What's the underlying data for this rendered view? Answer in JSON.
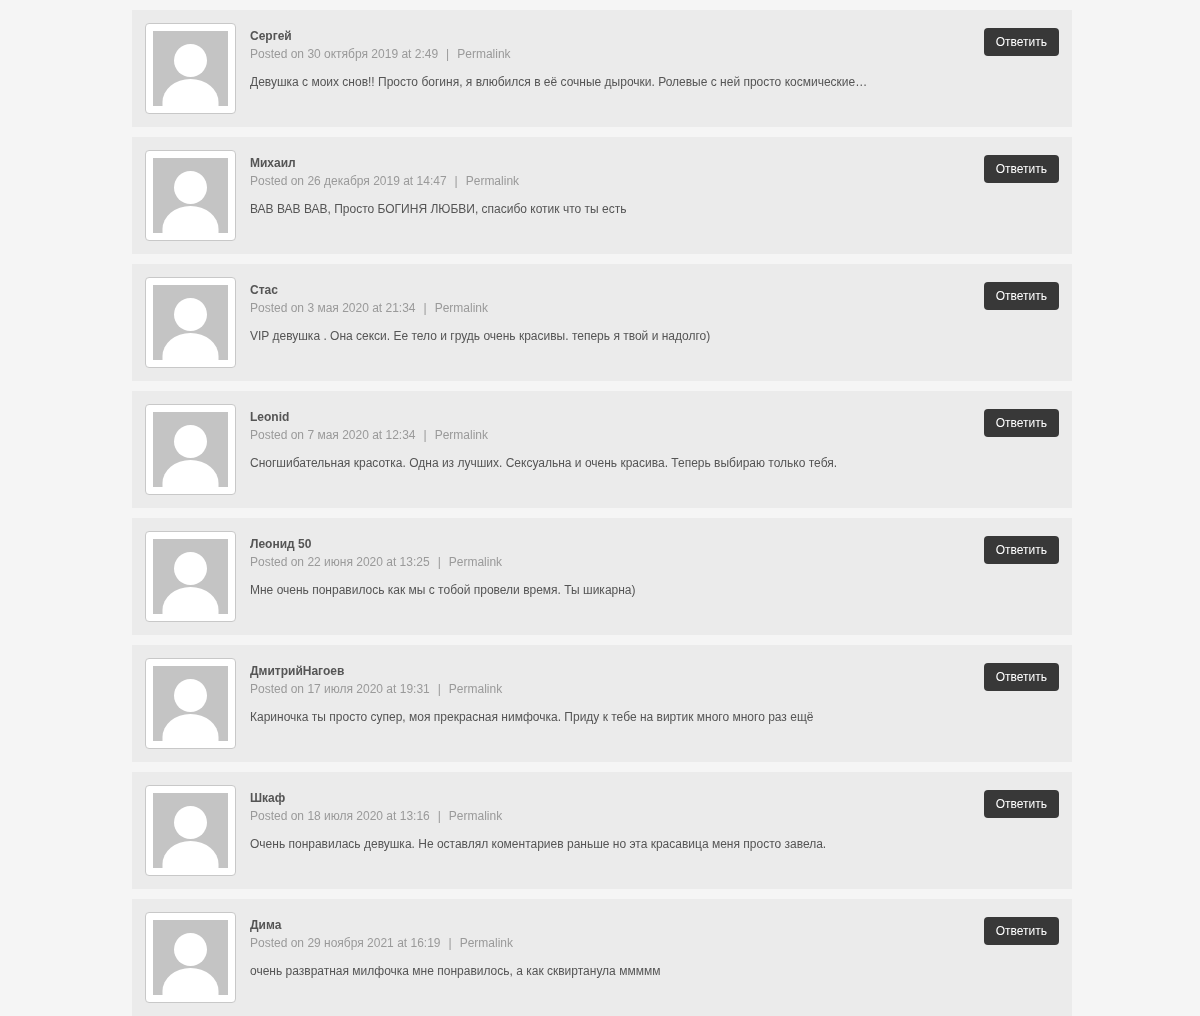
{
  "comments": [
    {
      "author": "Сергей",
      "posted": "Posted on 30 октября 2019 at 2:49",
      "separator": "|",
      "permalink": "Permalink",
      "text": "Девушка с моих снов!! Просто богиня, я влюбился в её сочные дырочки. Ролевые с ней просто космические…",
      "reply": "Ответить"
    },
    {
      "author": "Михаил",
      "posted": "Posted on 26 декабря 2019 at 14:47",
      "separator": "|",
      "permalink": "Permalink",
      "text": "ВАВ ВАВ ВАВ, Просто БОГИНЯ ЛЮБВИ, спасибо котик что ты есть",
      "reply": "Ответить"
    },
    {
      "author": "Стас",
      "posted": "Posted on 3 мая 2020 at 21:34",
      "separator": "|",
      "permalink": "Permalink",
      "text": "VIP девушка . Она секси. Ее тело и грудь очень красивы. теперь я твой и надолго)",
      "reply": "Ответить"
    },
    {
      "author": "Leonid",
      "posted": "Posted on 7 мая 2020 at 12:34",
      "separator": "|",
      "permalink": "Permalink",
      "text": "Сногшибательная красотка. Одна из лучших. Сексуальна и очень красива. Теперь выбираю только тебя.",
      "reply": "Ответить"
    },
    {
      "author": "Леонид 50",
      "posted": "Posted on 22 июня 2020 at 13:25",
      "separator": "|",
      "permalink": "Permalink",
      "text": "Мне очень понравилось как мы с тобой провели время. Ты шикарна)",
      "reply": "Ответить"
    },
    {
      "author": "ДмитрийНагоев",
      "posted": "Posted on 17 июля 2020 at 19:31",
      "separator": "|",
      "permalink": "Permalink",
      "text": "Кариночка ты просто супер, моя прекрасная нимфочка. Приду к тебе на виртик много много раз ещё",
      "reply": "Ответить"
    },
    {
      "author": "Шкаф",
      "posted": "Posted on 18 июля 2020 at 13:16",
      "separator": "|",
      "permalink": "Permalink",
      "text": "Очень понравилась девушка. Не оставлял коментариев раньше но эта красавица меня просто завела.",
      "reply": "Ответить"
    },
    {
      "author": "Дима",
      "posted": "Posted on 29 ноября 2021 at 16:19",
      "separator": "|",
      "permalink": "Permalink",
      "text": "очень развратная милфочка мне понравилось, а как сквиртанула ммммм",
      "reply": "Ответить"
    }
  ]
}
